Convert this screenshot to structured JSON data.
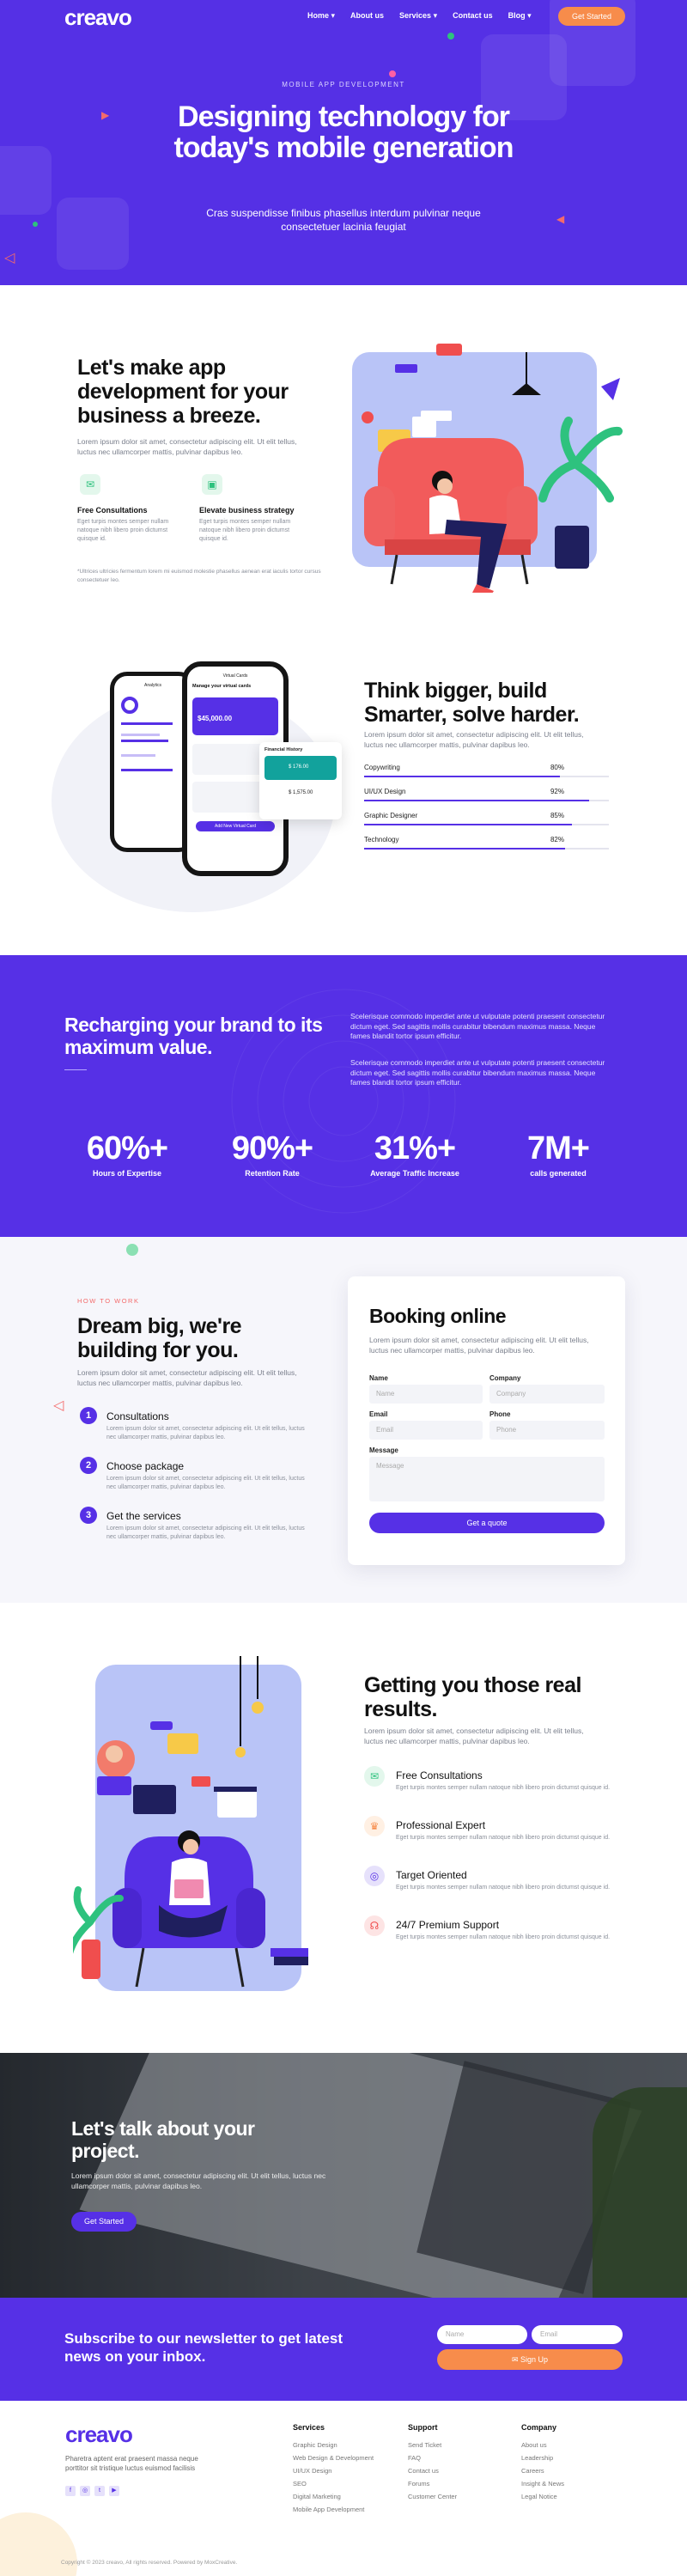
{
  "nav": {
    "logo": "creavo",
    "links": [
      "Home ▾",
      "About us",
      "Services ▾",
      "Contact us",
      "Blog ▾"
    ],
    "cta": "Get Started"
  },
  "hero": {
    "eyebrow": "MOBILE APP DEVELOPMENT",
    "title": "Designing technology for today's mobile generation",
    "subtitle": "Cras suspendisse finibus phasellus interdum pulvinar neque consectetuer lacinia feugiat"
  },
  "intro": {
    "title": "Let's make app development for your business a breeze.",
    "text": "Lorem ipsum dolor sit amet, consectetur adipiscing elit. Ut elit tellus, luctus nec ullamcorper mattis, pulvinar dapibus leo.",
    "features": [
      {
        "title": "Free Consultations",
        "text": "Eget turpis montes semper nullam natoque nibh libero proin dictumst quisque id."
      },
      {
        "title": "Elevate business strategy",
        "text": "Eget turpis montes semper nullam natoque nibh libero proin dictumst quisque id."
      }
    ],
    "footnote": "*Ultrices ultricies fermentum lorem mi euismod molestie phasellus aenean erat iaculis tortor cursus consectetuer leo."
  },
  "think": {
    "title": "Think bigger, build Smarter, solve harder.",
    "text": "Lorem ipsum dolor sit amet, consectetur adipiscing elit. Ut elit tellus, luctus nec ullamcorper mattis, pulvinar dapibus leo.",
    "skills": [
      {
        "label": "Copywriting",
        "value": "80%",
        "pct": 80
      },
      {
        "label": "UI/UX Design",
        "value": "92%",
        "pct": 92
      },
      {
        "label": "Graphic Designer",
        "value": "85%",
        "pct": 85
      },
      {
        "label": "Technology",
        "value": "82%",
        "pct": 82
      }
    ],
    "phone": {
      "left_title": "Analytics",
      "right_title": "Virtual Cards",
      "card_label": "Manage your virtual cards",
      "balance": "$45,000.00",
      "fin_title": "Financial History",
      "fin_amount": "$ 176.00",
      "fin_amount2": "$ 1,575.00",
      "button": "Add New Virtual Card"
    }
  },
  "brand": {
    "title": "Recharging your brand to its maximum value.",
    "p1": "Scelerisque commodo imperdiet ante ut vulputate potenti praesent consectetur dictum eget. Sed sagittis mollis curabitur bibendum maximus massa. Neque fames blandit tortor ipsum efficitur.",
    "p2": "Scelerisque commodo imperdiet ante ut vulputate potenti praesent consectetur dictum eget. Sed sagittis mollis curabitur bibendum maximus massa. Neque fames blandit tortor ipsum efficitur.",
    "stats": [
      {
        "num": "60%+",
        "label": "Hours of Expertise"
      },
      {
        "num": "90%+",
        "label": "Retention Rate"
      },
      {
        "num": "31%+",
        "label": "Average Traffic Increase"
      },
      {
        "num": "7M+",
        "label": "calls generated"
      }
    ]
  },
  "how": {
    "eyebrow": "HOW TO WORK",
    "title": "Dream big, we're building for you.",
    "text": "Lorem ipsum dolor sit amet, consectetur adipiscing elit. Ut elit tellus, luctus nec ullamcorper mattis, pulvinar dapibus leo.",
    "steps": [
      {
        "num": "1",
        "title": "Consultations",
        "text": "Lorem ipsum dolor sit amet, consectetur adipiscing elit. Ut elit tellus, luctus nec ullamcorper mattis, pulvinar dapibus leo."
      },
      {
        "num": "2",
        "title": "Choose package",
        "text": "Lorem ipsum dolor sit amet, consectetur adipiscing elit. Ut elit tellus, luctus nec ullamcorper mattis, pulvinar dapibus leo."
      },
      {
        "num": "3",
        "title": "Get the services",
        "text": "Lorem ipsum dolor sit amet, consectetur adipiscing elit. Ut elit tellus, luctus nec ullamcorper mattis, pulvinar dapibus leo."
      }
    ]
  },
  "booking": {
    "title": "Booking online",
    "text": "Lorem ipsum dolor sit amet, consectetur adipiscing elit. Ut elit tellus, luctus nec ullamcorper mattis, pulvinar dapibus leo.",
    "name_label": "Name",
    "name_ph": "Name",
    "company_label": "Company",
    "company_ph": "Company",
    "email_label": "Email",
    "email_ph": "Email",
    "phone_label": "Phone",
    "phone_ph": "Phone",
    "message_label": "Message",
    "message_ph": "Message",
    "button": "Get a quote"
  },
  "results": {
    "title": "Getting you those real results.",
    "text": "Lorem ipsum dolor sit amet, consectetur adipiscing elit. Ut elit tellus, luctus nec ullamcorper mattis, pulvinar dapibus leo.",
    "items": [
      {
        "title": "Free Consultations",
        "text": "Eget turpis montes semper nullam natoque nibh libero proin dictumst quisque id."
      },
      {
        "title": "Professional Expert",
        "text": "Eget turpis montes semper nullam natoque nibh libero proin dictumst quisque id."
      },
      {
        "title": "Target Oriented",
        "text": "Eget turpis montes semper nullam natoque nibh libero proin dictumst quisque id."
      },
      {
        "title": "24/7 Premium Support",
        "text": "Eget turpis montes semper nullam natoque nibh libero proin dictumst quisque id."
      }
    ]
  },
  "talk": {
    "title": "Let's talk about your project.",
    "text": "Lorem ipsum dolor sit amet, consectetur adipiscing elit. Ut elit tellus, luctus nec ullamcorper mattis, pulvinar dapibus leo.",
    "button": "Get Started"
  },
  "newsletter": {
    "title": "Subscribe to our newsletter to get latest news on your inbox.",
    "name_ph": "Name",
    "email_ph": "Email",
    "button": "✉ Sign Up"
  },
  "footer": {
    "logo": "creavo",
    "tagline": "Pharetra aptent erat praesent massa neque porttitor sit tristique luctus euismod facilisis",
    "cols": [
      {
        "title": "Services",
        "items": [
          "Graphic Design",
          "Web Design & Development",
          "UI/UX Design",
          "SEO",
          "Digital Marketing",
          "Mobile App Development"
        ]
      },
      {
        "title": "Support",
        "items": [
          "Send Ticket",
          "FAQ",
          "Contact us",
          "Forums",
          "Customer Center"
        ]
      },
      {
        "title": "Company",
        "items": [
          "About us",
          "Leadership",
          "Careers",
          "Insight & News",
          "Legal Notice"
        ]
      }
    ],
    "copyright": "Copyright © 2023 creavo, All rights reserved. Powered by MoxCreative."
  },
  "colors": {
    "primary": "#5630e6",
    "accent": "#f78c4b",
    "green": "#2ec27e"
  }
}
